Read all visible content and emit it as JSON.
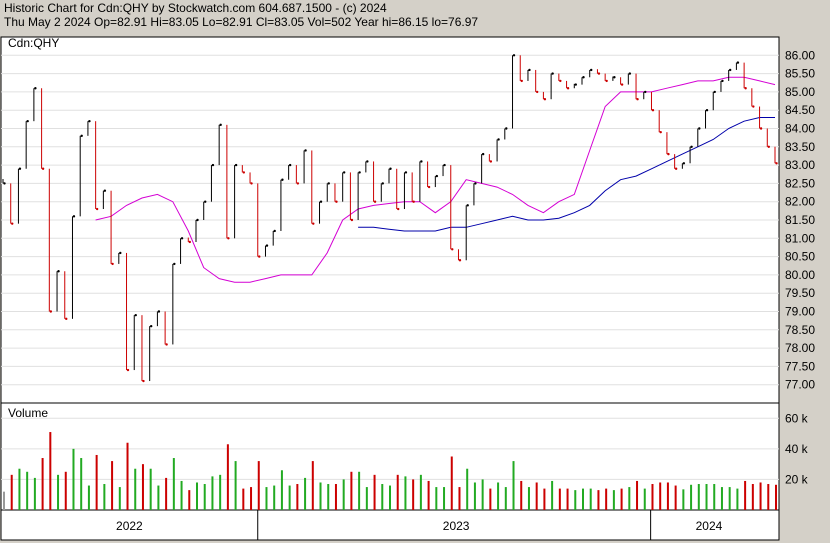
{
  "header": {
    "line1": "Historic Chart for Cdn:QHY by Stockwatch.com 604.687.1500 - (c) 2024",
    "line2": "Thu May  2 2024   Op=82.91  Hi=83.05  Lo=82.91  Cl=83.05  Vol=502  Year hi=86.15  lo=76.97"
  },
  "colors": {
    "background": "#d4d0c8",
    "plot_bg": "#ffffff",
    "price_up": "#000000",
    "price_down": "#cc0000",
    "ma_fast": "#d400d4",
    "ma_slow": "#0000aa",
    "vol_up": "#22aa22",
    "vol_down": "#cc0000",
    "vol_neutral": "#999999"
  },
  "chart_data": [
    {
      "type": "line",
      "panel": "price",
      "symbol_label": "Cdn:QHY",
      "ylim": [
        76.5,
        86.5
      ],
      "y_ticks": [
        "86.00",
        "85.50",
        "85.00",
        "84.50",
        "84.00",
        "83.50",
        "83.00",
        "82.50",
        "82.00",
        "81.50",
        "81.00",
        "80.50",
        "80.00",
        "79.50",
        "79.00",
        "78.50",
        "78.00",
        "77.50",
        "77.00"
      ],
      "x_labels": [
        "2022",
        "2023",
        "2024"
      ],
      "x_label_fracs": [
        0.165,
        0.585,
        0.91
      ],
      "x_separator_fracs": [
        0.33,
        0.835
      ],
      "grid": true,
      "series": [
        {
          "role": "price",
          "x_fracs": [
            0.0,
            0.01,
            0.02,
            0.03,
            0.04,
            0.05,
            0.06,
            0.07,
            0.08,
            0.09,
            0.1,
            0.11,
            0.12,
            0.13,
            0.14,
            0.15,
            0.16,
            0.17,
            0.18,
            0.19,
            0.2,
            0.21,
            0.22,
            0.23,
            0.24,
            0.25,
            0.26,
            0.27,
            0.28,
            0.29,
            0.3,
            0.31,
            0.32,
            0.33,
            0.34,
            0.35,
            0.36,
            0.37,
            0.38,
            0.39,
            0.4,
            0.41,
            0.42,
            0.43,
            0.44,
            0.45,
            0.46,
            0.47,
            0.48,
            0.49,
            0.5,
            0.51,
            0.52,
            0.53,
            0.54,
            0.55,
            0.56,
            0.57,
            0.58,
            0.59,
            0.6,
            0.61,
            0.62,
            0.63,
            0.64,
            0.65,
            0.66,
            0.67,
            0.68,
            0.69,
            0.7,
            0.71,
            0.72,
            0.73,
            0.74,
            0.75,
            0.76,
            0.77,
            0.78,
            0.79,
            0.8,
            0.81,
            0.82,
            0.83,
            0.84,
            0.85,
            0.86,
            0.87,
            0.88,
            0.89,
            0.9,
            0.91,
            0.92,
            0.93,
            0.94,
            0.95,
            0.96,
            0.97,
            0.98,
            0.99,
            1.0
          ],
          "values": [
            82.5,
            81.4,
            82.9,
            84.2,
            85.1,
            82.9,
            79.0,
            80.1,
            78.8,
            81.6,
            83.8,
            84.2,
            81.8,
            82.3,
            80.3,
            80.6,
            77.4,
            78.9,
            77.1,
            78.6,
            79.0,
            78.1,
            80.3,
            81.0,
            80.9,
            81.5,
            82.0,
            83.0,
            84.1,
            81.0,
            83.0,
            82.8,
            82.5,
            80.5,
            80.8,
            81.2,
            82.6,
            83.0,
            82.5,
            83.4,
            81.4,
            82.0,
            82.5,
            82.0,
            82.8,
            81.5,
            82.8,
            83.1,
            82.0,
            82.5,
            82.9,
            81.8,
            82.8,
            82.0,
            83.1,
            82.4,
            82.7,
            83.0,
            80.7,
            80.4,
            81.9,
            82.5,
            83.3,
            83.1,
            83.7,
            84.0,
            86.0,
            85.3,
            85.6,
            85.0,
            84.8,
            85.5,
            85.3,
            85.1,
            85.2,
            85.4,
            85.6,
            85.5,
            85.3,
            85.4,
            85.2,
            85.5,
            84.8,
            85.0,
            84.5,
            83.9,
            83.3,
            82.9,
            83.05,
            83.5,
            84.0,
            84.5,
            85.0,
            85.3,
            85.6,
            85.8,
            85.1,
            84.6,
            84.0,
            83.5,
            83.05
          ]
        },
        {
          "role": "ma_fast",
          "x_fracs": [
            0.12,
            0.14,
            0.16,
            0.18,
            0.2,
            0.22,
            0.24,
            0.26,
            0.28,
            0.3,
            0.32,
            0.34,
            0.36,
            0.38,
            0.4,
            0.42,
            0.44,
            0.46,
            0.48,
            0.5,
            0.52,
            0.54,
            0.56,
            0.58,
            0.6,
            0.62,
            0.64,
            0.66,
            0.68,
            0.7,
            0.72,
            0.74,
            0.76,
            0.78,
            0.8,
            0.82,
            0.84,
            0.86,
            0.88,
            0.9,
            0.92,
            0.94,
            0.96,
            0.98,
            1.0
          ],
          "values": [
            81.5,
            81.6,
            81.9,
            82.1,
            82.2,
            82.0,
            81.2,
            80.2,
            79.9,
            79.8,
            79.8,
            79.9,
            80.0,
            80.0,
            80.0,
            80.6,
            81.5,
            81.8,
            81.9,
            81.95,
            82.0,
            82.0,
            81.7,
            82.0,
            82.6,
            82.5,
            82.4,
            82.2,
            81.9,
            81.7,
            82.0,
            82.2,
            83.4,
            84.6,
            85.0,
            85.0,
            85.0,
            85.1,
            85.2,
            85.3,
            85.3,
            85.4,
            85.4,
            85.3,
            85.2
          ]
        },
        {
          "role": "ma_slow",
          "x_fracs": [
            0.46,
            0.48,
            0.5,
            0.52,
            0.54,
            0.56,
            0.58,
            0.6,
            0.62,
            0.64,
            0.66,
            0.68,
            0.7,
            0.72,
            0.74,
            0.76,
            0.78,
            0.8,
            0.82,
            0.84,
            0.86,
            0.88,
            0.9,
            0.92,
            0.94,
            0.96,
            0.98,
            1.0
          ],
          "values": [
            81.3,
            81.3,
            81.25,
            81.2,
            81.2,
            81.2,
            81.3,
            81.3,
            81.4,
            81.5,
            81.6,
            81.5,
            81.5,
            81.55,
            81.7,
            81.9,
            82.3,
            82.6,
            82.7,
            82.9,
            83.1,
            83.3,
            83.5,
            83.7,
            84.0,
            84.2,
            84.3,
            84.3
          ]
        }
      ]
    },
    {
      "type": "bar",
      "panel": "volume",
      "title": "Volume",
      "ylim": [
        0,
        70
      ],
      "y_ticks": [
        "60 k",
        "40 k",
        "20 k"
      ],
      "y_tick_values": [
        60,
        40,
        20
      ]
    }
  ]
}
